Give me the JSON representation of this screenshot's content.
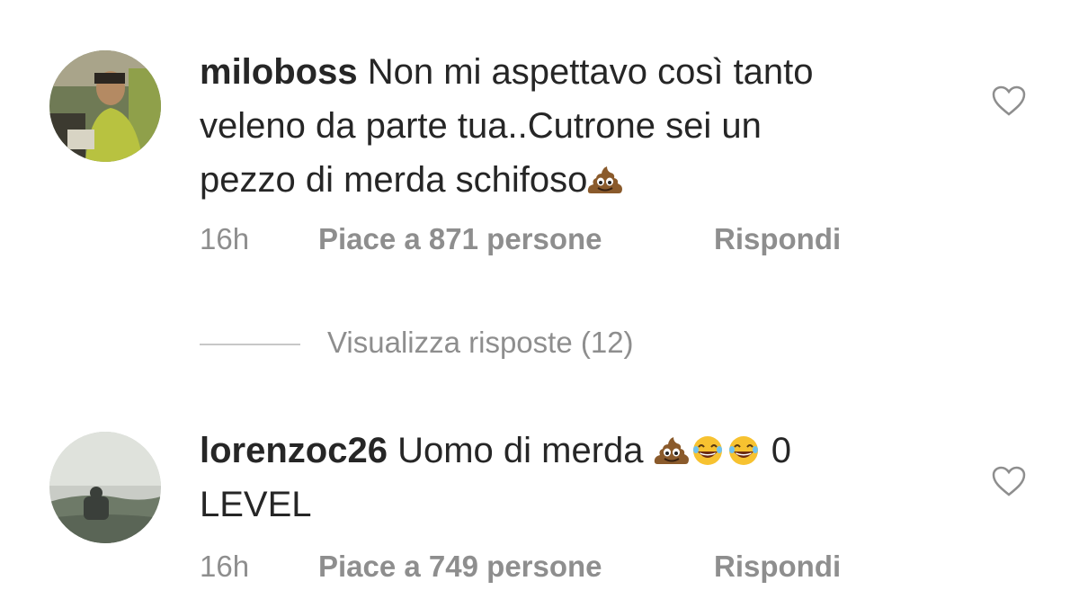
{
  "comments": [
    {
      "username": "miloboss",
      "text_line1": " Non mi aspettavo così tanto",
      "text_line2": "veleno da parte tua..Cutrone sei un",
      "text_line3": "pezzo di merda schifoso",
      "emojis": [
        "pile-of-poo-icon"
      ],
      "time": "16h",
      "likes": "Piace a 871 persone",
      "reply_label": "Rispondi"
    },
    {
      "username": "lorenzoc26",
      "text_line1": " Uomo di merda ",
      "text_after_emojis": " 0",
      "text_line2": "LEVEL",
      "emojis": [
        "pile-of-poo-icon",
        "laughing-face-icon",
        "laughing-face-icon"
      ],
      "time": "16h",
      "likes": "Piace a 749 persone",
      "reply_label": "Rispondi"
    }
  ],
  "view_replies": "Visualizza risposte (12)",
  "icons": {
    "like": "heart-outline-icon"
  },
  "colors": {
    "text": "#262626",
    "secondary": "#8e8e8e",
    "divider": "#c7c7c7"
  }
}
